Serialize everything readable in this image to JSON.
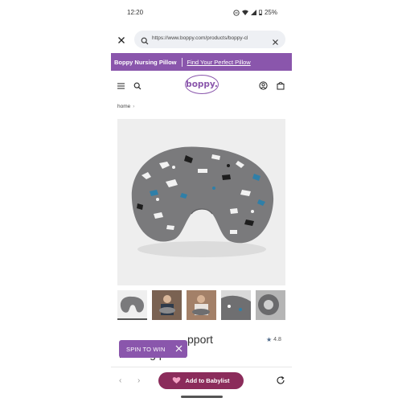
{
  "status_bar": {
    "time": "12:20",
    "battery": "25%"
  },
  "browser": {
    "url": "https://www.boppy.com/products/boppy-cl"
  },
  "promo": {
    "left": "Boppy Nursing Pillow",
    "right": "Find Your Perfect Pillow"
  },
  "header": {
    "logo_text": "boppy."
  },
  "breadcrumb": {
    "home": "home",
    "chevron": "›"
  },
  "product": {
    "title_line1": "original support",
    "title_line1_visible": "pport",
    "title_line2": "nursing pillow",
    "rating": "4.8",
    "star": "★",
    "color_brand": "#8a56ac",
    "color_cta": "#8b2c5b"
  },
  "popup": {
    "label": "SPIN TO WIN",
    "close": "✕"
  },
  "bottom_bar": {
    "back": "‹",
    "forward": "›",
    "cta": "Add to Babylist"
  }
}
